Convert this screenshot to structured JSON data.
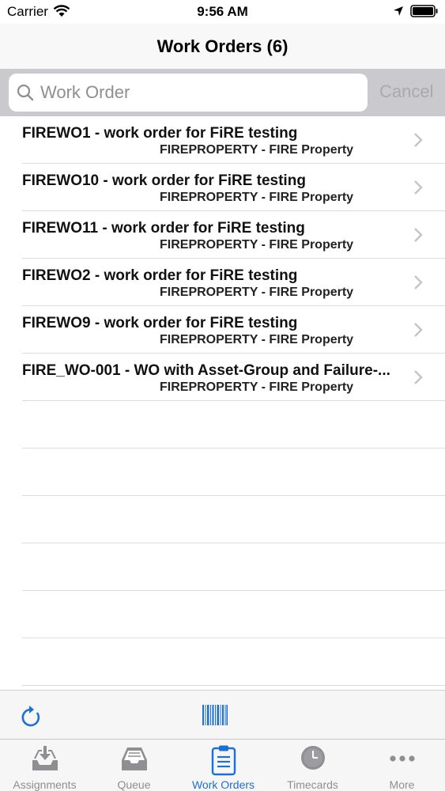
{
  "status_bar": {
    "carrier": "Carrier",
    "time": "9:56 AM"
  },
  "nav": {
    "title": "Work Orders (6)"
  },
  "search": {
    "placeholder": "Work Order",
    "value": "",
    "cancel_label": "Cancel"
  },
  "work_orders": [
    {
      "title": "FIREWO1 - work order for FiRE testing",
      "subtitle": "FIREPROPERTY - FIRE Property"
    },
    {
      "title": "FIREWO10 - work order for FiRE testing",
      "subtitle": "FIREPROPERTY - FIRE Property"
    },
    {
      "title": "FIREWO11 - work order for FiRE testing",
      "subtitle": "FIREPROPERTY - FIRE Property"
    },
    {
      "title": "FIREWO2 - work order for FiRE testing",
      "subtitle": "FIREPROPERTY - FIRE Property"
    },
    {
      "title": "FIREWO9 - work order for FiRE testing",
      "subtitle": "FIREPROPERTY - FIRE Property"
    },
    {
      "title": "FIRE_WO-001 - WO with Asset-Group and Failure-...",
      "subtitle": "FIREPROPERTY - FIRE Property"
    }
  ],
  "toolbar": {
    "left_icon": "refresh-icon",
    "center_icon": "barcode-icon"
  },
  "tabs": [
    {
      "label": "Assignments",
      "icon": "inbox-download-icon",
      "active": false
    },
    {
      "label": "Queue",
      "icon": "tray-icon",
      "active": false
    },
    {
      "label": "Work Orders",
      "icon": "clipboard-icon",
      "active": true
    },
    {
      "label": "Timecards",
      "icon": "clock-icon",
      "active": false
    },
    {
      "label": "More",
      "icon": "more-dots-icon",
      "active": false
    }
  ],
  "colors": {
    "accent": "#1d6fd6",
    "inactive": "#8e8e93",
    "search_bg": "#c9c9ce"
  }
}
